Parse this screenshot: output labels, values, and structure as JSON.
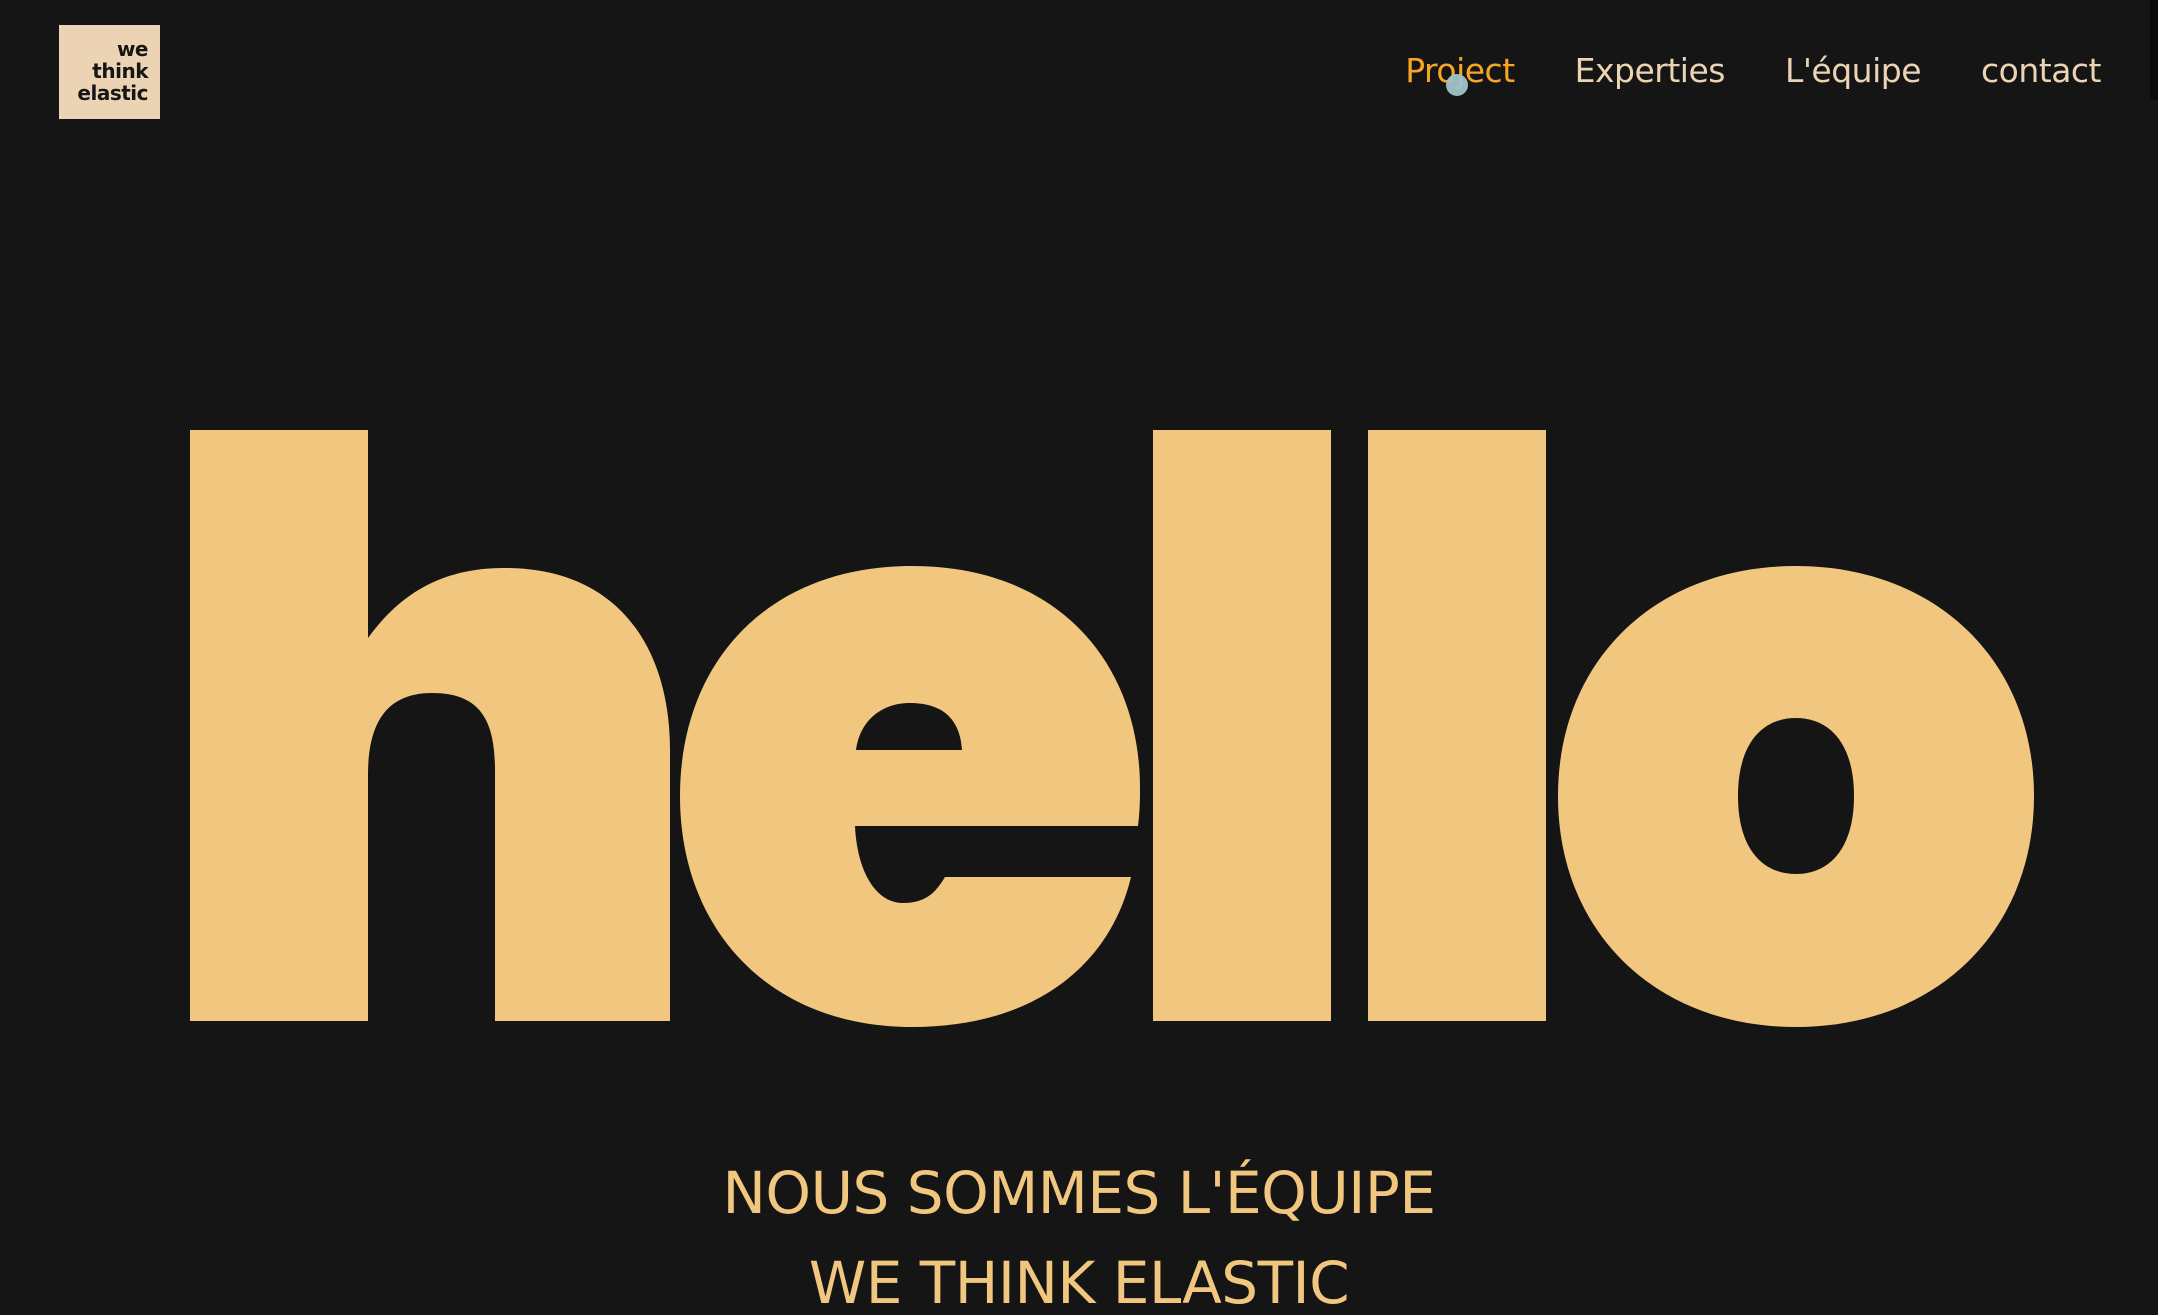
{
  "logo": {
    "line1": "we",
    "line2": "think",
    "line3": "elastic"
  },
  "nav": {
    "items": [
      {
        "label": "Project",
        "active": true
      },
      {
        "label": "Experties",
        "active": false
      },
      {
        "label": "L'équipe",
        "active": false
      },
      {
        "label": "contact",
        "active": false
      }
    ]
  },
  "hero": {
    "word": "hello"
  },
  "tagline": {
    "line1": "NOUS SOMMES L'ÉQUIPE",
    "line2": "WE THINK ELASTIC"
  },
  "colors": {
    "background": "#151515",
    "accent": "#f1c67f",
    "active_nav": "#f5a623",
    "nav_text": "#ebd3b4",
    "logo_bg": "#ebd3b4"
  }
}
